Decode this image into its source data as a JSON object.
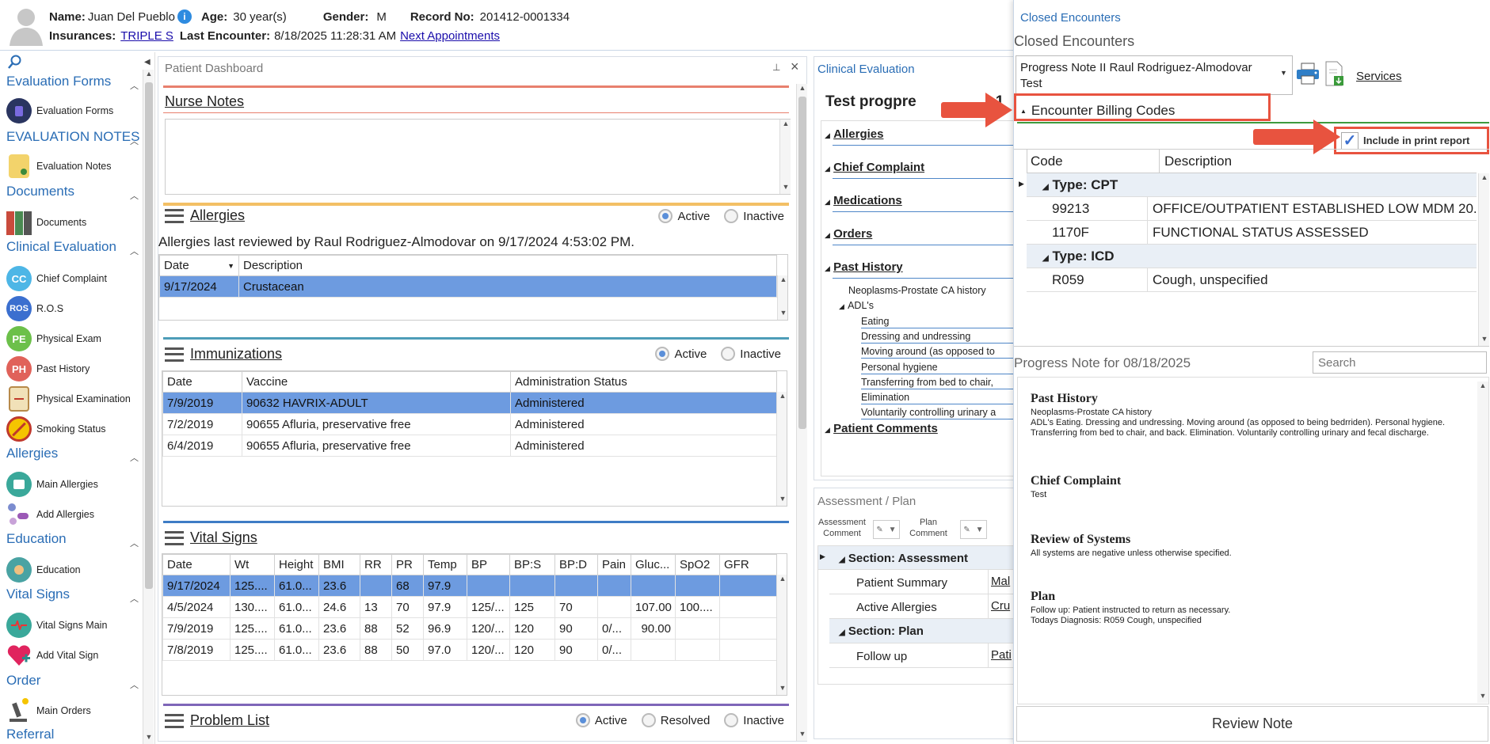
{
  "patient": {
    "name_label": "Name:",
    "name": "Juan Del Pueblo",
    "age_label": "Age:",
    "age": "30 year(s)",
    "gender_label": "Gender:",
    "gender": "M",
    "record_label": "Record No:",
    "record": "201412-0001334",
    "ins_label": "Insurances:",
    "insurance": "TRIPLE S",
    "last_label": "Last Encounter:",
    "last_encounter": "8/18/2025 11:28:31 AM",
    "next_appt": "Next Appointments"
  },
  "sidebar": {
    "sections": [
      {
        "title": "Evaluation Forms",
        "items": [
          "Evaluation Forms"
        ]
      },
      {
        "title": "EVALUATION NOTES",
        "items": [
          "Evaluation Notes"
        ]
      },
      {
        "title": "Documents",
        "items": [
          "Documents"
        ]
      },
      {
        "title": "Clinical Evaluation",
        "items": [
          "Chief Complaint",
          "R.O.S",
          "Physical Exam",
          "Past History",
          "Physical Examination",
          "Smoking Status"
        ]
      },
      {
        "title": "Allergies",
        "items": [
          "Main Allergies",
          "Add Allergies"
        ]
      },
      {
        "title": "Education",
        "items": [
          "Education"
        ]
      },
      {
        "title": "Vital Signs",
        "items": [
          "Vital Signs Main",
          "Add Vital Sign"
        ]
      },
      {
        "title": "Order",
        "items": [
          "Main Orders"
        ]
      },
      {
        "title": "Referral",
        "items": []
      }
    ],
    "icon_text": {
      "cc": "CC",
      "ros": "ROS",
      "pe": "PE",
      "ph": "PH"
    }
  },
  "dashboard": {
    "title": "Patient Dashboard",
    "nurse_notes": "Nurse Notes",
    "allergies": {
      "title": "Allergies",
      "active": "Active",
      "inactive": "Inactive",
      "reviewed": "Allergies last reviewed by Raul Rodriguez-Almodovar on 9/17/2024 4:53:02 PM.",
      "headers": [
        "Date",
        "Description"
      ],
      "rows": [
        [
          "9/17/2024",
          "Crustacean"
        ]
      ]
    },
    "immunizations": {
      "title": "Immunizations",
      "active": "Active",
      "inactive": "Inactive",
      "headers": [
        "Date",
        "Vaccine",
        "Administration Status"
      ],
      "rows": [
        [
          "7/9/2019",
          "90632 HAVRIX-ADULT",
          "Administered"
        ],
        [
          "7/2/2019",
          "90655 Afluria, preservative free",
          "Administered"
        ],
        [
          "6/4/2019",
          "90655 Afluria, preservative free",
          "Administered"
        ]
      ]
    },
    "vitals": {
      "title": "Vital Signs",
      "headers": [
        "Date",
        "Wt",
        "Height",
        "BMI",
        "RR",
        "PR",
        "Temp",
        "BP",
        "BP:S",
        "BP:D",
        "Pain",
        "Gluc...",
        "SpO2",
        "GFR"
      ],
      "rows": [
        [
          "9/17/2024",
          "125....",
          "61.0...",
          "23.6",
          "",
          "68",
          "97.9",
          "",
          "",
          "",
          "",
          "",
          "",
          ""
        ],
        [
          "4/5/2024",
          "130....",
          "61.0...",
          "24.6",
          "13",
          "70",
          "97.9",
          "125/...",
          "125",
          "70",
          "",
          "107.00",
          "100....",
          ""
        ],
        [
          "7/9/2019",
          "125....",
          "61.0...",
          "23.6",
          "88",
          "52",
          "96.9",
          "120/...",
          "120",
          "90",
          "0/...",
          "90.00",
          "",
          ""
        ],
        [
          "7/8/2019",
          "125....",
          "61.0...",
          "23.6",
          "88",
          "50",
          "97.0",
          "120/...",
          "120",
          "90",
          "0/...",
          "",
          "",
          ""
        ]
      ]
    },
    "problems": {
      "title": "Problem List",
      "active": "Active",
      "resolved": "Resolved",
      "inactive": "Inactive"
    }
  },
  "clinical": {
    "title": "Clinical Evaluation",
    "heading": "Test progpre",
    "heading_tail": "1",
    "items": [
      "Allergies",
      "Chief Complaint",
      "Medications",
      "Orders",
      "Past History"
    ],
    "past_history_children": [
      "Neoplasms-Prostate CA history",
      "ADL's"
    ],
    "adl_children": [
      "Eating",
      "Dressing and undressing",
      "Moving around (as opposed to",
      "Personal hygiene",
      "Transferring from bed to chair,",
      "Elimination",
      "Voluntarily controlling urinary a"
    ],
    "more": "Patient Comments"
  },
  "assessment": {
    "title": "Assessment / Plan",
    "assessment_comment": "Assessment Comment",
    "plan_comment": "Plan Comment",
    "section_assessment": "Section: Assessment",
    "patient_summary": "Patient Summary",
    "ps_value": "Mal",
    "active_allergies": "Active Allergies",
    "aa_value": "Cru",
    "section_plan": "Section: Plan",
    "follow_up": "Follow up",
    "fu_value": "Pati"
  },
  "closed": {
    "tab": "Closed Encounters",
    "title": "Closed Encounters",
    "encounter": "Progress Note II Raul Rodriguez-Almodovar Test",
    "services": "Services",
    "billing": "Encounter Billing Codes",
    "include_print": "Include in print report",
    "headers": [
      "Code",
      "Description"
    ],
    "groups": [
      {
        "type": "Type: CPT",
        "rows": [
          [
            "99213",
            "OFFICE/OUTPATIENT ESTABLISHED LOW MDM 20..."
          ],
          [
            "1170F",
            "FUNCTIONAL STATUS ASSESSED"
          ]
        ]
      },
      {
        "type": "Type: ICD",
        "rows": [
          [
            "R059",
            "Cough, unspecified"
          ]
        ]
      }
    ],
    "progress_title": "Progress Note for 08/18/2025",
    "search_placeholder": "Search",
    "note": [
      {
        "h": "Past History",
        "p": [
          "Neoplasms-Prostate CA history",
          "ADL's Eating. Dressing and undressing. Moving around (as opposed to being bedrriden). Personal hygiene. Transferring from bed to chair, and back. Elimination. Voluntarily controlling urinary and fecal discharge."
        ]
      },
      {
        "h": "Chief Complaint",
        "p": [
          "Test"
        ]
      },
      {
        "h": "Review of Systems",
        "p": [
          "All systems are negative unless otherwise specified."
        ]
      },
      {
        "h": "Plan",
        "p": [
          "Follow up: Patient instructed to return as necessary.",
          "Todays Diagnosis: R059 Cough, unspecified"
        ]
      }
    ],
    "review_note": "Review Note"
  },
  "colors": {
    "accent": "#2a6db5",
    "selection": "#6d9be0",
    "callout": "#e8533f"
  }
}
